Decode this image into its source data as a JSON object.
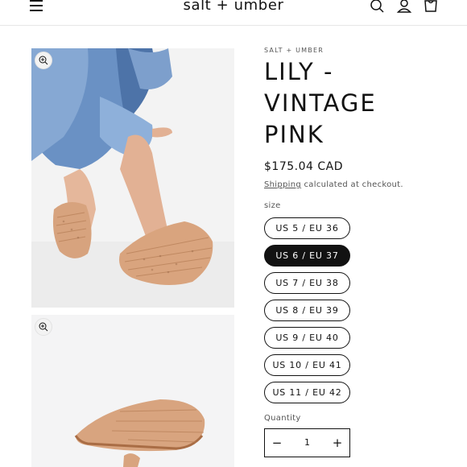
{
  "header": {
    "brand": "salt + umber",
    "icons": [
      "menu-icon",
      "search-icon",
      "account-icon",
      "cart-icon"
    ]
  },
  "media": {
    "images": [
      {
        "name": "product-photo-worn",
        "zoom_icon": "zoom-icon"
      },
      {
        "name": "product-photo-side",
        "zoom_icon": "zoom-icon"
      }
    ]
  },
  "product": {
    "vendor": "SALT + UMBER",
    "title_lines": [
      "LILY -",
      "VINTAGE",
      "PINK"
    ],
    "price": "$175.04 CAD",
    "shipping_link": "Shipping",
    "shipping_text": " calculated at checkout.",
    "size_label": "size",
    "sizes": [
      "US 5 / EU 36",
      "US 6 / EU 37",
      "US 7 / EU 38",
      "US 8 / EU 39",
      "US 9 / EU 40",
      "US 10 / EU 41",
      "US 11 / EU 42"
    ],
    "selected_size": "US 6 / EU 37",
    "quantity_label": "Quantity",
    "quantity": "1",
    "minus": "−",
    "plus": "+"
  }
}
